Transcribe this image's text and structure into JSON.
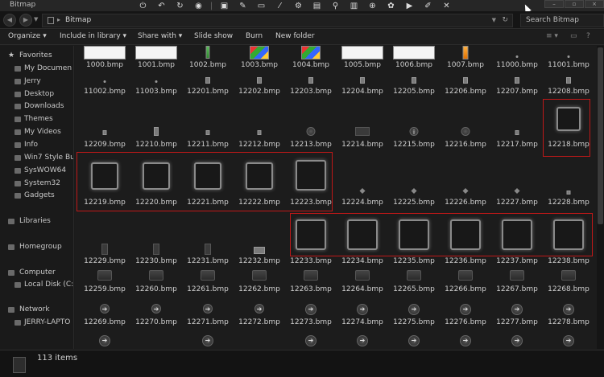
{
  "window": {
    "title": "Bitmap"
  },
  "toolbar_icons": [
    "power-icon",
    "undo-icon",
    "refresh-icon",
    "globe-icon",
    "window-icon",
    "tool-icon",
    "monitor-icon",
    "brush-icon",
    "settings-icon",
    "image-icon",
    "people-icon",
    "trash-icon",
    "zoom-icon",
    "flower-icon",
    "slideshow-icon",
    "edit-icon",
    "close-icon"
  ],
  "address": {
    "path": "Bitmap",
    "search_placeholder": "Search Bitmap"
  },
  "commands": {
    "organize": "Organize",
    "include": "Include in library",
    "share": "Share with",
    "slideshow": "Slide show",
    "burn": "Burn",
    "new_folder": "New folder"
  },
  "sidebar": {
    "favorites": "Favorites",
    "items": [
      "My Documen",
      "Jerry",
      "Desktop",
      "Downloads",
      "Themes",
      "My Videos",
      "Info",
      "Win7 Style Bu",
      "SysWOW64",
      "System32",
      "Gadgets"
    ],
    "libraries": "Libraries",
    "homegroup": "Homegroup",
    "computer": "Computer",
    "local_disk": "Local Disk (C:)",
    "network": "Network",
    "network_pc": "JERRY-LAPTO"
  },
  "files": {
    "row0": [
      "1000.bmp",
      "1001.bmp",
      "1002.bmp",
      "1003.bmp",
      "1004.bmp",
      "1005.bmp",
      "1006.bmp",
      "1007.bmp",
      "11000.bmp",
      "11001.bmp"
    ],
    "row1": [
      "11002.bmp",
      "11003.bmp",
      "12201.bmp",
      "12202.bmp",
      "12203.bmp",
      "12204.bmp",
      "12205.bmp",
      "12206.bmp",
      "12207.bmp",
      "12208.bmp"
    ],
    "row2": [
      "12209.bmp",
      "12210.bmp",
      "12211.bmp",
      "12212.bmp",
      "12213.bmp",
      "12214.bmp",
      "12215.bmp",
      "12216.bmp",
      "12217.bmp",
      "12218.bmp"
    ],
    "row3": [
      "12219.bmp",
      "12220.bmp",
      "12221.bmp",
      "12222.bmp",
      "12223.bmp",
      "12224.bmp",
      "12225.bmp",
      "12226.bmp",
      "12227.bmp",
      "12228.bmp"
    ],
    "row4": [
      "12229.bmp",
      "12230.bmp",
      "12231.bmp",
      "12232.bmp",
      "12233.bmp",
      "12234.bmp",
      "12235.bmp",
      "12236.bmp",
      "12237.bmp",
      "12238.bmp"
    ],
    "row5": [
      "12259.bmp",
      "12260.bmp",
      "12261.bmp",
      "12262.bmp",
      "12263.bmp",
      "12264.bmp",
      "12265.bmp",
      "12266.bmp",
      "12267.bmp",
      "12268.bmp"
    ],
    "row6": [
      "12269.bmp",
      "12270.bmp",
      "12271.bmp",
      "12272.bmp",
      "12273.bmp",
      "12274.bmp",
      "12275.bmp",
      "12276.bmp",
      "12277.bmp",
      "12278.bmp"
    ]
  },
  "status": {
    "count": "113 items"
  },
  "colors": {
    "highlight": "#c01818",
    "background": "#1c1c1c"
  }
}
